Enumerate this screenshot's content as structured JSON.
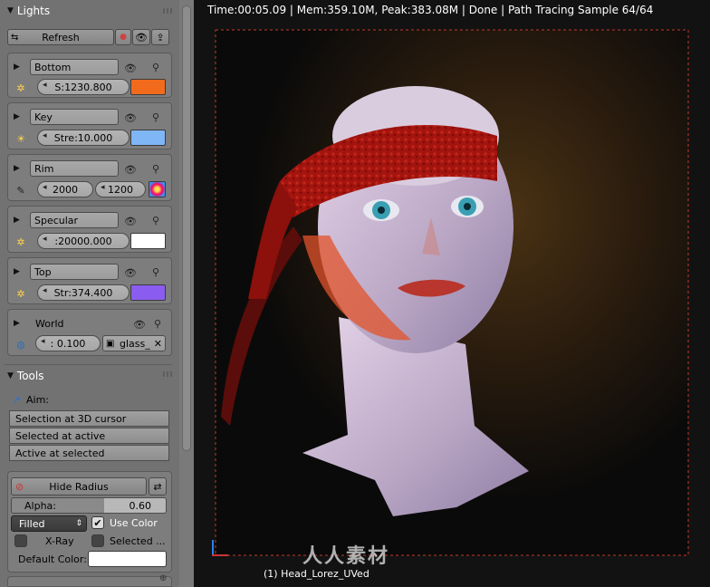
{
  "lights_panel": {
    "title": "Lights",
    "refresh_label": "Refresh",
    "lights": [
      {
        "name": "Bottom",
        "value": "S:1230.800",
        "color": "#f26b1d"
      },
      {
        "name": "Key",
        "value": "Stre:10.000",
        "color": "#7fb6f5"
      },
      {
        "name": "Rim",
        "value1": "2000",
        "value2": "1200"
      },
      {
        "name": "Specular",
        "value": ":20000.000",
        "color": "#ffffff"
      },
      {
        "name": "Top",
        "value": "Str:374.400",
        "color": "#8b5cf0"
      }
    ],
    "world": {
      "name": "World",
      "value": ": 0.100",
      "material": "glass_"
    }
  },
  "tools_panel": {
    "title": "Tools",
    "aim_label": "Aim:",
    "aim_options": [
      "Selection at 3D cursor",
      "Selected at active",
      "Active at selected"
    ],
    "hide_radius_label": "Hide Radius",
    "alpha_label": "Alpha:",
    "alpha_value": "0.60",
    "fill_mode": "Filled",
    "use_color_label": "Use Color",
    "use_color_checked": true,
    "xray_label": "X-Ray",
    "selected_label": "Selected ...",
    "default_color_label": "Default Color:",
    "default_color": "#ffffff"
  },
  "viewport": {
    "status": "Time:00:05.09 | Mem:359.10M, Peak:383.08M | Done | Path Tracing Sample 64/64",
    "object_name": "(1) Head_Lorez_UVed",
    "watermark": "人人素材"
  }
}
